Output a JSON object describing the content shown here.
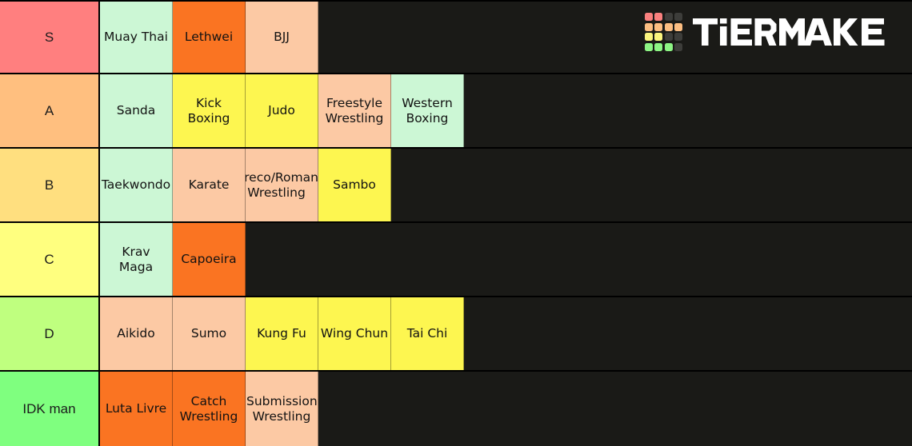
{
  "brand": {
    "name": "TIERMAKER",
    "grid_colors": [
      [
        "#f9807e",
        "#f9807e",
        "#3d3d3a",
        "#3d3d3a"
      ],
      [
        "#fcbe82",
        "#fcbe82",
        "#fcbe82",
        "#fcbe82"
      ],
      [
        "#fbf47e",
        "#fbf47e",
        "#3d3d3a",
        "#3d3d3a"
      ],
      [
        "#8df584",
        "#8df584",
        "#8df584",
        "#3d3d3a"
      ]
    ]
  },
  "palette": {
    "background": "#1a1a17",
    "border": "#000000",
    "mint": "#ccf7d5",
    "orange": "#fa7422",
    "peach": "#fcc9a4",
    "yellow": "#fdf650"
  },
  "tiers": [
    {
      "label": "S",
      "color": "#ff7f7f",
      "items": [
        {
          "label": "Muay Thai",
          "color": "#ccf7d5"
        },
        {
          "label": "Lethwei",
          "color": "#fa7422"
        },
        {
          "label": "BJJ",
          "color": "#fcc9a4"
        }
      ]
    },
    {
      "label": "A",
      "color": "#ffbf7f",
      "items": [
        {
          "label": "Sanda",
          "color": "#ccf7d5"
        },
        {
          "label": "Kick\nBoxing",
          "color": "#fdf650"
        },
        {
          "label": "Judo",
          "color": "#fdf650"
        },
        {
          "label": "Freestyle\nWrestling",
          "color": "#fcc9a4"
        },
        {
          "label": "Western\nBoxing",
          "color": "#ccf7d5"
        }
      ]
    },
    {
      "label": "B",
      "color": "#ffdf7f",
      "items": [
        {
          "label": "Taekwondo",
          "color": "#ccf7d5"
        },
        {
          "label": "Karate",
          "color": "#fcc9a4"
        },
        {
          "label": "Greco/Roman\nWrestling",
          "color": "#fcc9a4",
          "clipped": true
        },
        {
          "label": "Sambo",
          "color": "#fdf650"
        }
      ]
    },
    {
      "label": "C",
      "color": "#ffff7f",
      "items": [
        {
          "label": "Krav\nMaga",
          "color": "#ccf7d5"
        },
        {
          "label": "Capoeira",
          "color": "#fa7422"
        }
      ]
    },
    {
      "label": "D",
      "color": "#bfff7f",
      "items": [
        {
          "label": "Aikido",
          "color": "#fcc9a4"
        },
        {
          "label": "Sumo",
          "color": "#fcc9a4"
        },
        {
          "label": "Kung Fu",
          "color": "#fdf650"
        },
        {
          "label": "Wing Chun",
          "color": "#fdf650"
        },
        {
          "label": "Tai Chi",
          "color": "#fdf650"
        }
      ]
    },
    {
      "label": "IDK man",
      "color": "#7fff7f",
      "items": [
        {
          "label": "Luta Livre",
          "color": "#fa7422"
        },
        {
          "label": "Catch\nWrestling",
          "color": "#fa7422"
        },
        {
          "label": "Submission\nWrestling",
          "color": "#fcc9a4"
        }
      ]
    }
  ]
}
